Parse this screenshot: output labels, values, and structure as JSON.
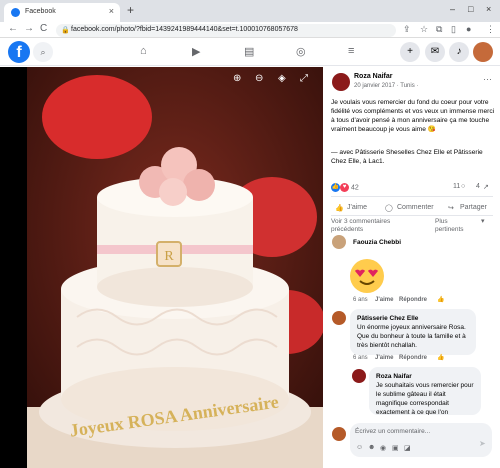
{
  "browser": {
    "tab_title": "Facebook",
    "tab_close": "×",
    "new_tab": "+",
    "url": "facebook.com/photo/?fbid=1439241989444140&set=t.100010768057678",
    "nav_back": "←",
    "nav_forward": "→",
    "nav_reload": "C",
    "win_min": "–",
    "win_max": "□",
    "win_close": "×"
  },
  "photo": {
    "cake_text_line1": "Joyeux ROSA Anniversaire",
    "monogram": "R"
  },
  "post": {
    "author": "Roza Naifar",
    "date": "20 janvier 2017 · Tunis ·",
    "text": "Je voulais vous remercier du fond du coeur pour votre fidélité vos compléments et vos veux un immense merci à tous d'avoir pensé à mon anniversaire ça me touche vraiment beaucoup je vous aime 😘",
    "tagged": "— avec Pâtisserie Sheselles Chez Elle et Pâtisserie Chez Elle, à Lac1.",
    "reaction_count": "42",
    "comment_count": "11",
    "share_count": "4",
    "like_label": "J'aime",
    "comment_label": "Commenter",
    "share_label": "Partager",
    "prev_comments": "Voir 3 commentaires précédents",
    "sort_label": "Plus pertinents"
  },
  "comments": [
    {
      "author": "Faouzia Chebbi",
      "time": "6 ans",
      "like": "J'aime",
      "reply": "Répondre"
    },
    {
      "author": "Pâtisserie Chez Elle",
      "text": "Un énorme joyeux anniversaire Rosa. Que du bonheur à toute la famille et à très bientôt nchallah.",
      "time": "6 ans",
      "like": "J'aime",
      "reply": "Répondre"
    },
    {
      "author": "Roza Naifar",
      "text": "Je souhaitais vous remercier pour le sublime gâteau il était magnifique correspondait exactement à ce que l'on"
    }
  ],
  "composer": {
    "placeholder": "Écrivez un commentaire..."
  },
  "colors": {
    "fb_blue": "#1877f2",
    "like_blue": "#1877f2",
    "love_red": "#f33e58"
  }
}
